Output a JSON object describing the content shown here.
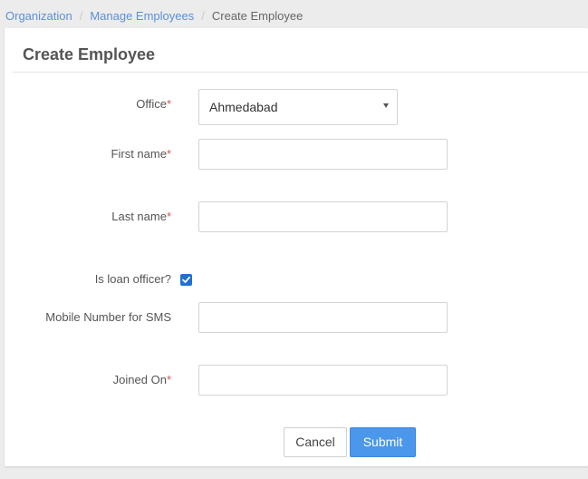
{
  "breadcrumb": {
    "items": [
      "Organization",
      "Manage Employees",
      "Create Employee"
    ],
    "separator": "/"
  },
  "page": {
    "title": "Create Employee"
  },
  "form": {
    "office": {
      "label": "Office",
      "value": "Ahmedabad",
      "required": true
    },
    "first_name": {
      "label": "First name",
      "value": "",
      "required": true
    },
    "last_name": {
      "label": "Last name",
      "value": "",
      "required": true
    },
    "is_loan_officer": {
      "label": "Is loan officer?",
      "checked": true
    },
    "mobile": {
      "label": "Mobile Number for SMS",
      "value": ""
    },
    "joined_on": {
      "label": "Joined On",
      "value": "",
      "required": true
    },
    "required_marker": "*"
  },
  "actions": {
    "cancel_label": "Cancel",
    "submit_label": "Submit"
  },
  "colors": {
    "link": "#5b8fd9",
    "required": "#d9534f",
    "primary": "#4a97eb",
    "checkbox": "#1f6fd6"
  },
  "icons": {
    "dropdown": "caret-down-icon",
    "check": "checkmark-icon"
  }
}
